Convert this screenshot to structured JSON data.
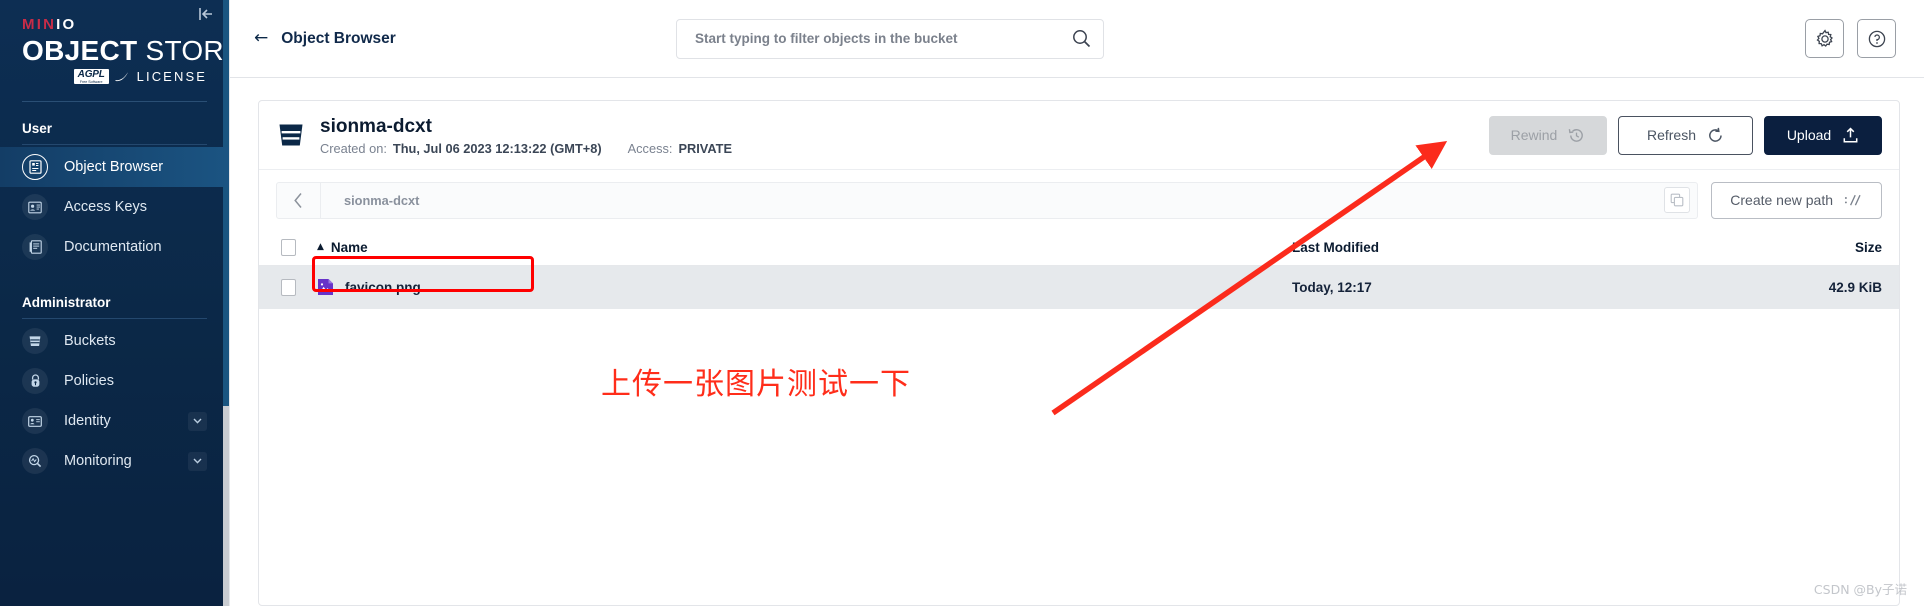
{
  "sidebar": {
    "logo": {
      "min": "MIN",
      "io": "IO",
      "object": "OBJECT",
      "store": "STORE",
      "agpl": "AGPL",
      "agpl_sub": "Free Software",
      "license": "LICENSE"
    },
    "collapse_label": "|←",
    "sections": [
      {
        "label": "User",
        "items": [
          {
            "label": "Object Browser",
            "icon": "object-browser-icon",
            "active": true,
            "expandable": false
          },
          {
            "label": "Access Keys",
            "icon": "access-keys-icon",
            "active": false,
            "expandable": false
          },
          {
            "label": "Documentation",
            "icon": "documentation-icon",
            "active": false,
            "expandable": false
          }
        ]
      },
      {
        "label": "Administrator",
        "items": [
          {
            "label": "Buckets",
            "icon": "bucket-icon",
            "active": false,
            "expandable": false
          },
          {
            "label": "Policies",
            "icon": "lock-icon",
            "active": false,
            "expandable": false
          },
          {
            "label": "Identity",
            "icon": "identity-icon",
            "active": false,
            "expandable": true
          },
          {
            "label": "Monitoring",
            "icon": "monitoring-icon",
            "active": false,
            "expandable": true
          }
        ]
      }
    ]
  },
  "topbar": {
    "back_arrow": "←",
    "title": "Object Browser",
    "search_placeholder": "Start typing to filter objects in the bucket",
    "search_value": "",
    "settings_icon": "gear-icon",
    "help_icon": "help-circle-icon"
  },
  "bucket": {
    "name": "sionma-dcxt",
    "created_label": "Created on:",
    "created_value": "Thu, Jul 06 2023 12:13:22 (GMT+8)",
    "access_label": "Access:",
    "access_value": "PRIVATE"
  },
  "actions": {
    "rewind": "Rewind",
    "rewind_icon": "rewind-clock-icon",
    "refresh": "Refresh",
    "refresh_icon": "refresh-icon",
    "upload": "Upload",
    "upload_icon": "upload-icon"
  },
  "path": {
    "back_icon": "chevron-left-icon",
    "current": "sionma-dcxt",
    "copy_icon": "copy-icon",
    "create_new_path": "Create new path",
    "create_new_path_icon": "path-slash-icon"
  },
  "table": {
    "columns": [
      {
        "key": "name",
        "label": "Name",
        "sorted": true,
        "sort_dir": "▲"
      },
      {
        "key": "modified",
        "label": "Last Modified",
        "sorted": false
      },
      {
        "key": "size",
        "label": "Size",
        "sorted": false
      }
    ],
    "rows": [
      {
        "name": "favicon.png",
        "icon": "image-file-icon",
        "modified": "Today, 12:17",
        "size": "42.9 KiB",
        "highlighted": true
      }
    ]
  },
  "annotations": {
    "note_text": "上传一张图片测试一下",
    "note_color": "#ff2d1a",
    "arrow_color": "#fb2b1c",
    "highlight_color": "#ff0000",
    "watermark": "CSDN @By子诺"
  },
  "colors": {
    "sidebar_bg": "#0b2847",
    "sidebar_active": "#1b5482",
    "brand_red": "#c72c48",
    "upload_bg": "#0b1f3f",
    "row_bg": "#e6e9ec"
  }
}
